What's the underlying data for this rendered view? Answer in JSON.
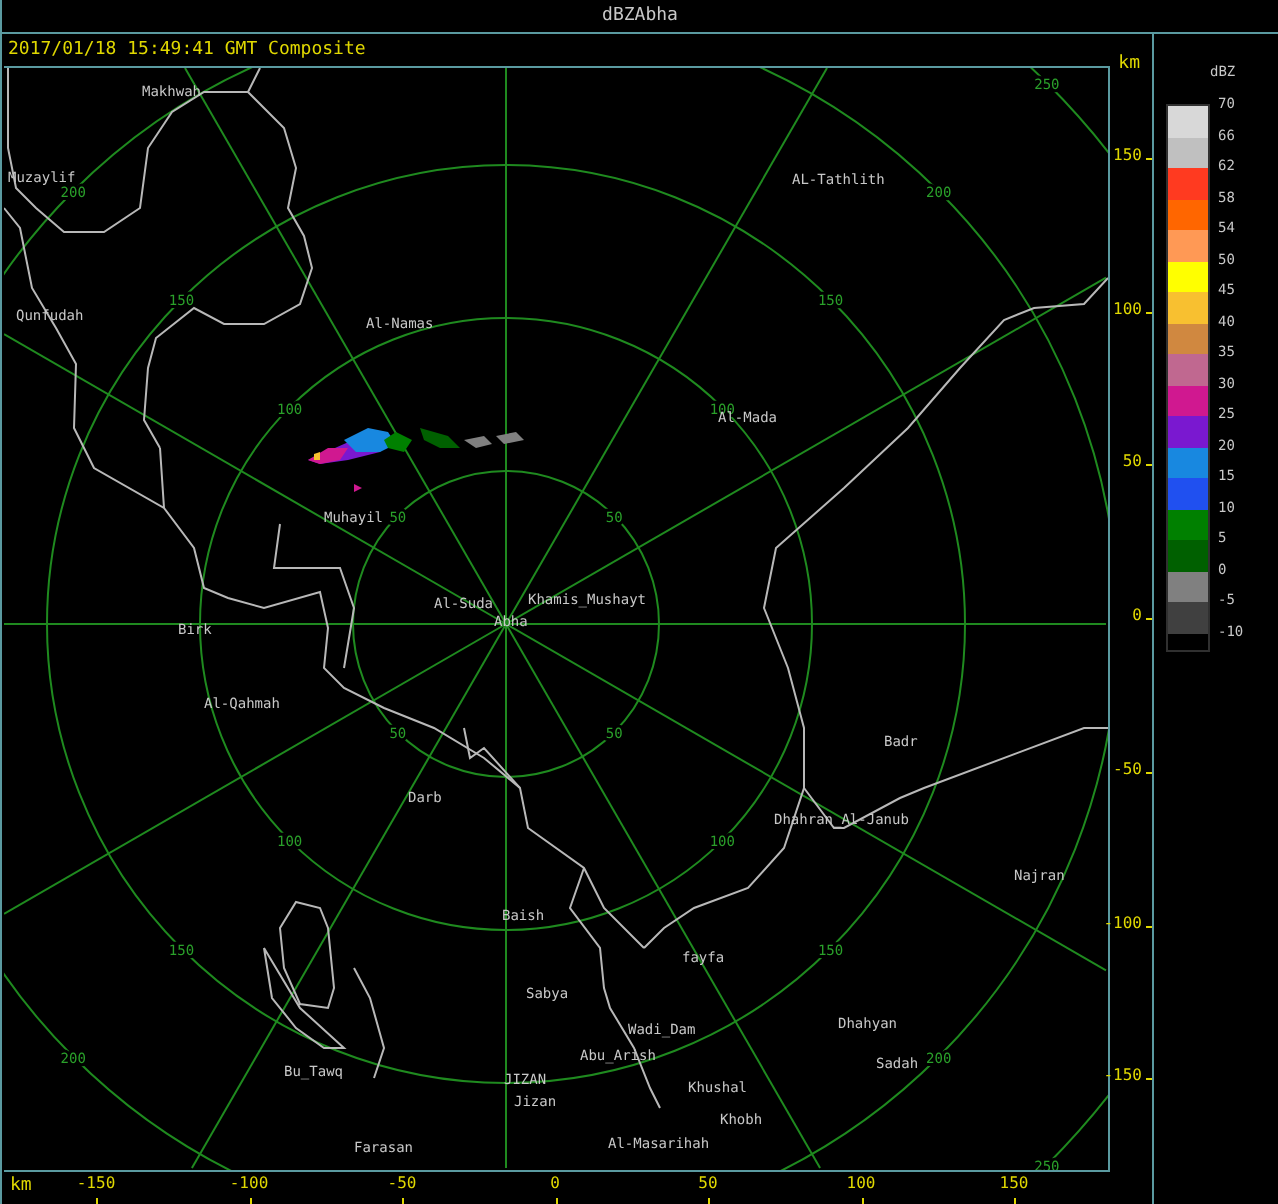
{
  "window": {
    "title": "dBZAbha"
  },
  "header": {
    "timestamp": "2017/01/18 15:49:41 GMT Composite"
  },
  "map": {
    "range_rings": [
      {
        "labels": [
          "50",
          "50",
          "50",
          "50"
        ]
      },
      {
        "labels": [
          "100",
          "100",
          "100",
          "100"
        ]
      },
      {
        "labels": [
          "150",
          "150",
          "150",
          "150"
        ]
      },
      {
        "labels": [
          "200",
          "200",
          "200",
          "200"
        ]
      },
      {
        "labels": [
          "250",
          "250"
        ]
      }
    ],
    "places": [
      {
        "name": "Makhwah"
      },
      {
        "name": "Muzaylif"
      },
      {
        "name": "Qunfudah"
      },
      {
        "name": "Al-Namas"
      },
      {
        "name": "AL-Tathlith"
      },
      {
        "name": "Al-Mada"
      },
      {
        "name": "Muhayil"
      },
      {
        "name": "Al-Suda"
      },
      {
        "name": "Khamis_Mushayt"
      },
      {
        "name": "Abha"
      },
      {
        "name": "Birk"
      },
      {
        "name": "Al-Qahmah"
      },
      {
        "name": "Badr"
      },
      {
        "name": "Darb"
      },
      {
        "name": "Dhahran_Al-Janub"
      },
      {
        "name": "Najran"
      },
      {
        "name": "Baish"
      },
      {
        "name": "fayfa"
      },
      {
        "name": "Sabya"
      },
      {
        "name": "Wadi_Dam"
      },
      {
        "name": "Dhahyan"
      },
      {
        "name": "Abu_Arish"
      },
      {
        "name": "Sadah"
      },
      {
        "name": "Bu_Tawq"
      },
      {
        "name": "JIZAN"
      },
      {
        "name": "Jizan"
      },
      {
        "name": "Khushal"
      },
      {
        "name": "Khobh"
      },
      {
        "name": "Farasan"
      },
      {
        "name": "Al-Masarihah"
      }
    ]
  },
  "y_axis": {
    "unit": "km",
    "ticks": [
      "150",
      "100",
      "50",
      "0",
      "-50",
      "-100",
      "-150"
    ]
  },
  "x_axis": {
    "unit": "km",
    "ticks": [
      "-150",
      "-100",
      "-50",
      "0",
      "50",
      "100",
      "150"
    ]
  },
  "legend": {
    "title": "dBZ",
    "labels": [
      "70",
      "66",
      "62",
      "58",
      "54",
      "50",
      "45",
      "40",
      "35",
      "30",
      "25",
      "20",
      "15",
      "10",
      "5",
      "0",
      "-5",
      "-10"
    ],
    "bands": [
      {
        "color": "#d8d8d8"
      },
      {
        "color": "#c0c0c0"
      },
      {
        "color": "#ff3a20"
      },
      {
        "color": "#ff6600"
      },
      {
        "color": "#ff9955"
      },
      {
        "color": "#ffff00"
      },
      {
        "color": "#f8c030"
      },
      {
        "color": "#d08840"
      },
      {
        "color": "#c06890"
      },
      {
        "color": "#d01890"
      },
      {
        "color": "#7a18d0"
      },
      {
        "color": "#1888e0"
      },
      {
        "color": "#2050f0"
      },
      {
        "color": "#008000"
      },
      {
        "color": "#006000"
      },
      {
        "color": "#808080"
      },
      {
        "color": "#404040"
      }
    ]
  }
}
